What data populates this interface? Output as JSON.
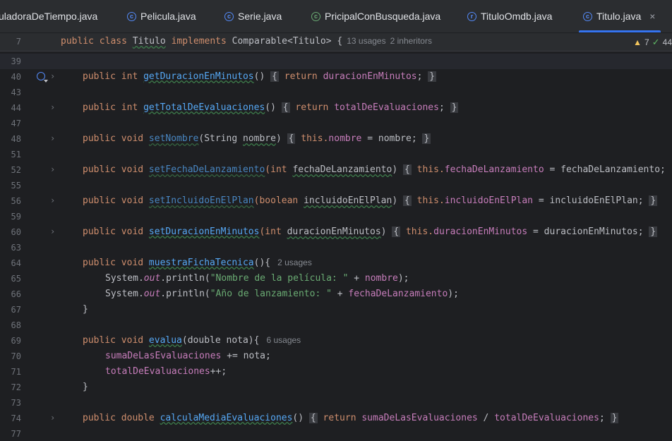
{
  "tabs": [
    {
      "label": "uladoraDeTiempo.java",
      "icon": "class-icon",
      "active": false
    },
    {
      "label": "Pelicula.java",
      "icon": "class-icon",
      "active": false
    },
    {
      "label": "Serie.java",
      "icon": "class-icon",
      "active": false
    },
    {
      "label": "PricipalConBusqueda.java",
      "icon": "main-class-icon",
      "active": false
    },
    {
      "label": "TituloOmdb.java",
      "icon": "record-icon",
      "active": false
    },
    {
      "label": "Titulo.java",
      "icon": "class-icon",
      "active": true
    }
  ],
  "tab_close": "×",
  "sticky": {
    "line": "7",
    "code_parts": [
      "public",
      " ",
      "class",
      " ",
      "Titulo",
      " ",
      "implements",
      " ",
      "Comparable<Titulo>",
      " {"
    ],
    "usages": "13 usages",
    "inheritors": "2 inheritors"
  },
  "inspections": {
    "warnings": "7",
    "ok": "44"
  },
  "lines": [
    {
      "n": "39",
      "current": true
    },
    {
      "n": "40",
      "fold": true,
      "gutter_icon": "implements-icon",
      "text": [
        "public int ",
        "getDuracionEnMinutos",
        "() ",
        "{",
        " return ",
        "duracionEnMinutos",
        "; ",
        "}"
      ]
    },
    {
      "n": "43"
    },
    {
      "n": "44",
      "fold": true,
      "text": [
        "public int ",
        "getTotalDeEvaluaciones",
        "() ",
        "{",
        " return ",
        "totalDeEvaluaciones",
        "; ",
        "}"
      ]
    },
    {
      "n": "47"
    },
    {
      "n": "48",
      "fold": true,
      "text": [
        "public void ",
        "setNombre",
        "(String ",
        "nombre",
        ") ",
        "{",
        " this.",
        "nombre",
        " = nombre; ",
        "}"
      ]
    },
    {
      "n": "51"
    },
    {
      "n": "52",
      "fold": true,
      "text": [
        "public void ",
        "setFechaDeLanzamiento",
        "(int ",
        "fechaDeLanzamiento",
        ") ",
        "{",
        " this.",
        "fechaDeLanzamiento",
        " = fechaDeLanzamiento",
        "; }"
      ]
    },
    {
      "n": "55"
    },
    {
      "n": "56",
      "fold": true,
      "text": [
        "public void ",
        "setIncluidoEnElPlan",
        "(boolean ",
        "incluidoEnElPlan",
        ") ",
        "{",
        " this.",
        "incluidoEnElPlan",
        " = incluidoEnElPlan; ",
        "}"
      ]
    },
    {
      "n": "59"
    },
    {
      "n": "60",
      "fold": true,
      "text": [
        "public void ",
        "setDuracionEnMinutos",
        "(int ",
        "duracionEnMinutos",
        ") ",
        "{",
        " this.",
        "duracionEnMinutos",
        " = duracionEnMinutos; ",
        "}"
      ]
    },
    {
      "n": "63"
    },
    {
      "n": "64",
      "text": [
        "public void ",
        "muestraFichaTecnica",
        "(){"
      ],
      "usages": "2 usages"
    },
    {
      "n": "65",
      "indent": true,
      "text": [
        "System.",
        "out",
        ".println(",
        "\"Nombre de la película: \"",
        " + ",
        "nombre",
        ");"
      ]
    },
    {
      "n": "66",
      "indent": true,
      "text": [
        "System.",
        "out",
        ".println(",
        "\"Año de lanzamiento: \"",
        " + ",
        "fechaDeLanzamiento",
        ");"
      ]
    },
    {
      "n": "67",
      "text": [
        "}"
      ]
    },
    {
      "n": "68"
    },
    {
      "n": "69",
      "text": [
        "public void ",
        "evalua",
        "(double nota){"
      ],
      "usages": "6 usages"
    },
    {
      "n": "70",
      "indent": true,
      "text": [
        "sumaDeLasEvaluaciones",
        " += nota;"
      ]
    },
    {
      "n": "71",
      "indent": true,
      "text": [
        "totalDeEvaluaciones",
        "++;"
      ]
    },
    {
      "n": "72",
      "text": [
        "}"
      ]
    },
    {
      "n": "73"
    },
    {
      "n": "74",
      "fold": true,
      "text": [
        "public double ",
        "calculaMediaEvaluaciones",
        "() ",
        "{",
        " return ",
        "sumaDeLasEvaluaciones",
        " / ",
        "totalDeEvaluaciones",
        "; ",
        "}"
      ]
    },
    {
      "n": "77"
    }
  ],
  "colors": {
    "keyword": "#cf8e6d",
    "method": "#56a8f5",
    "field": "#c77dbb",
    "string": "#6aab73",
    "accent": "#3574f0"
  }
}
